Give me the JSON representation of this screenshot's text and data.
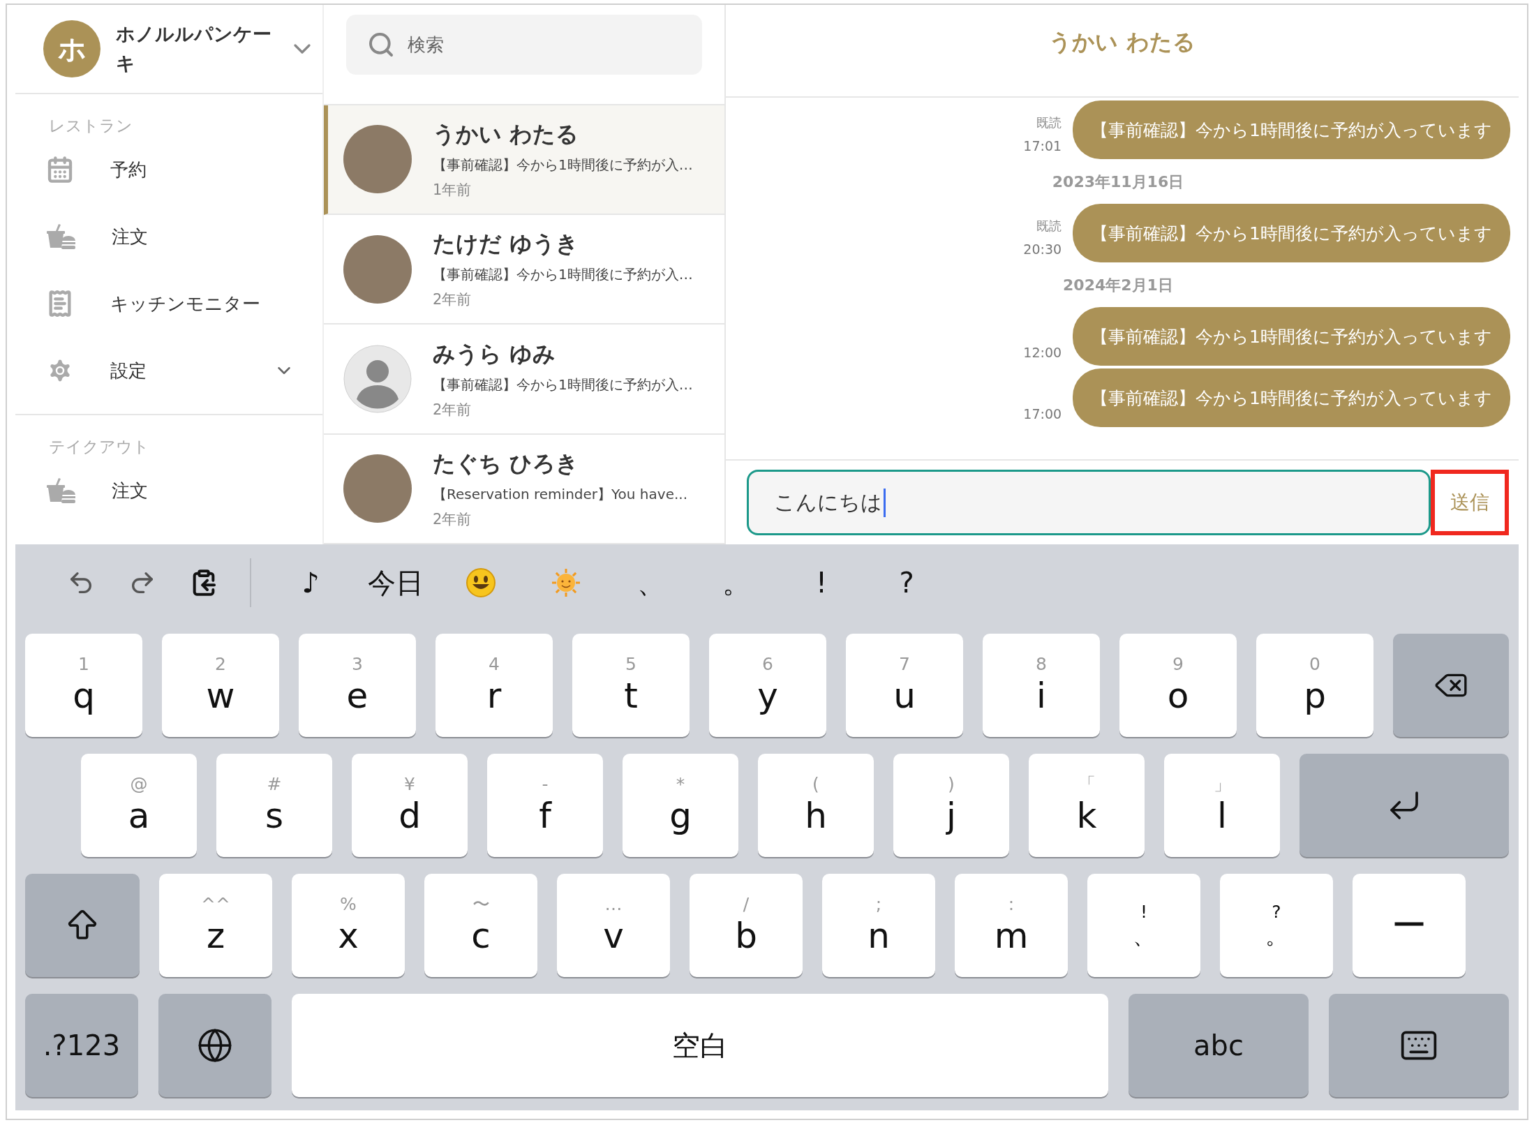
{
  "store": {
    "initial": "ホ",
    "name": "ホノルルパンケーキ"
  },
  "sidebar": {
    "sections": [
      {
        "title": "レストラン",
        "items": [
          {
            "label": "予約",
            "kind": "calendar",
            "expandable": false
          },
          {
            "label": "注文",
            "kind": "order",
            "expandable": false
          },
          {
            "label": "キッチンモニター",
            "kind": "receipt",
            "expandable": false
          },
          {
            "label": "設定",
            "kind": "settings",
            "expandable": true
          }
        ]
      },
      {
        "title": "テイクアウト",
        "items": [
          {
            "label": "注文",
            "kind": "order",
            "expandable": false
          }
        ]
      }
    ]
  },
  "search": {
    "placeholder": "検索"
  },
  "conversations": [
    {
      "name": "うかい わたる",
      "preview": "【事前確認】今から1時間後に予約が入…",
      "time": "1年前",
      "kind": "photo",
      "selected": true
    },
    {
      "name": "たけだ ゆうき",
      "preview": "【事前確認】今から1時間後に予約が入…",
      "time": "2年前",
      "kind": "photo",
      "selected": false
    },
    {
      "name": "みうら ゆみ",
      "preview": "【事前確認】今から1時間後に予約が入…",
      "time": "2年前",
      "kind": "default",
      "selected": false
    },
    {
      "name": "たぐち ひろき",
      "preview": "【Reservation reminder】You have...",
      "time": "2年前",
      "kind": "photo",
      "selected": false
    }
  ],
  "chat": {
    "title": "うかい わたる",
    "items": [
      {
        "kind": "message",
        "read": "既読",
        "time": "17:01",
        "text": "【事前確認】今から1時間後に予約が入っています"
      },
      {
        "kind": "date",
        "text": "2023年11月16日"
      },
      {
        "kind": "message",
        "read": "既読",
        "time": "20:30",
        "text": "【事前確認】今から1時間後に予約が入っています"
      },
      {
        "kind": "date",
        "text": "2024年2月1日"
      },
      {
        "kind": "message",
        "time": "12:00",
        "text": "【事前確認】今から1時間後に予約が入っています"
      },
      {
        "kind": "message",
        "time": "17:00",
        "text": "【事前確認】今から1時間後に予約が入っています"
      }
    ]
  },
  "composer": {
    "value": "こんにちは",
    "send": "送信",
    "highlighted": true
  },
  "keyboard": {
    "toolbar": [
      {
        "kind": "undo"
      },
      {
        "kind": "redo"
      },
      {
        "kind": "paste"
      },
      {
        "kind": "divider"
      },
      {
        "kind": "text",
        "label": "♪"
      },
      {
        "kind": "text",
        "label": "今日"
      },
      {
        "kind": "smiley"
      },
      {
        "kind": "sun"
      },
      {
        "kind": "text",
        "label": "、"
      },
      {
        "kind": "text",
        "label": "。"
      },
      {
        "kind": "text",
        "label": "!"
      },
      {
        "kind": "text",
        "label": "?"
      }
    ],
    "rows": [
      [
        {
          "kind": "letter",
          "hint": "1",
          "label": "q"
        },
        {
          "kind": "letter",
          "hint": "2",
          "label": "w"
        },
        {
          "kind": "letter",
          "hint": "3",
          "label": "e"
        },
        {
          "kind": "letter",
          "hint": "4",
          "label": "r"
        },
        {
          "kind": "letter",
          "hint": "5",
          "label": "t"
        },
        {
          "kind": "letter",
          "hint": "6",
          "label": "y"
        },
        {
          "kind": "letter",
          "hint": "7",
          "label": "u"
        },
        {
          "kind": "letter",
          "hint": "8",
          "label": "i"
        },
        {
          "kind": "letter",
          "hint": "9",
          "label": "o"
        },
        {
          "kind": "letter",
          "hint": "0",
          "label": "p"
        },
        {
          "kind": "delete"
        }
      ],
      [
        {
          "kind": "letter",
          "hint": "@",
          "label": "a"
        },
        {
          "kind": "letter",
          "hint": "#",
          "label": "s"
        },
        {
          "kind": "letter",
          "hint": "¥",
          "label": "d"
        },
        {
          "kind": "letter",
          "hint": "-",
          "label": "f"
        },
        {
          "kind": "letter",
          "hint": "*",
          "label": "g"
        },
        {
          "kind": "letter",
          "hint": "(",
          "label": "h"
        },
        {
          "kind": "letter",
          "hint": ")",
          "label": "j"
        },
        {
          "kind": "letter",
          "hint": "「",
          "label": "k"
        },
        {
          "kind": "letter",
          "hint": "」",
          "label": "l"
        },
        {
          "kind": "return"
        }
      ],
      [
        {
          "kind": "shift"
        },
        {
          "kind": "letter",
          "hint": "^^",
          "label": "z"
        },
        {
          "kind": "letter",
          "hint": "%",
          "label": "x"
        },
        {
          "kind": "letter",
          "hint": "〜",
          "label": "c"
        },
        {
          "kind": "letter",
          "hint": "…",
          "label": "v"
        },
        {
          "kind": "letter",
          "hint": "/",
          "label": "b"
        },
        {
          "kind": "letter",
          "hint": ";",
          "label": "n"
        },
        {
          "kind": "letter",
          "hint": ":",
          "label": "m"
        },
        {
          "kind": "punct",
          "hint": "!",
          "label": "、"
        },
        {
          "kind": "punct",
          "hint": "?",
          "label": "。"
        },
        {
          "kind": "letter",
          "label": "ー"
        }
      ],
      [
        {
          "kind": "mode",
          "label": ".?123"
        },
        {
          "kind": "globe"
        },
        {
          "kind": "space",
          "label": "空白"
        },
        {
          "kind": "abc",
          "label": "abc"
        },
        {
          "kind": "hide"
        }
      ]
    ]
  }
}
